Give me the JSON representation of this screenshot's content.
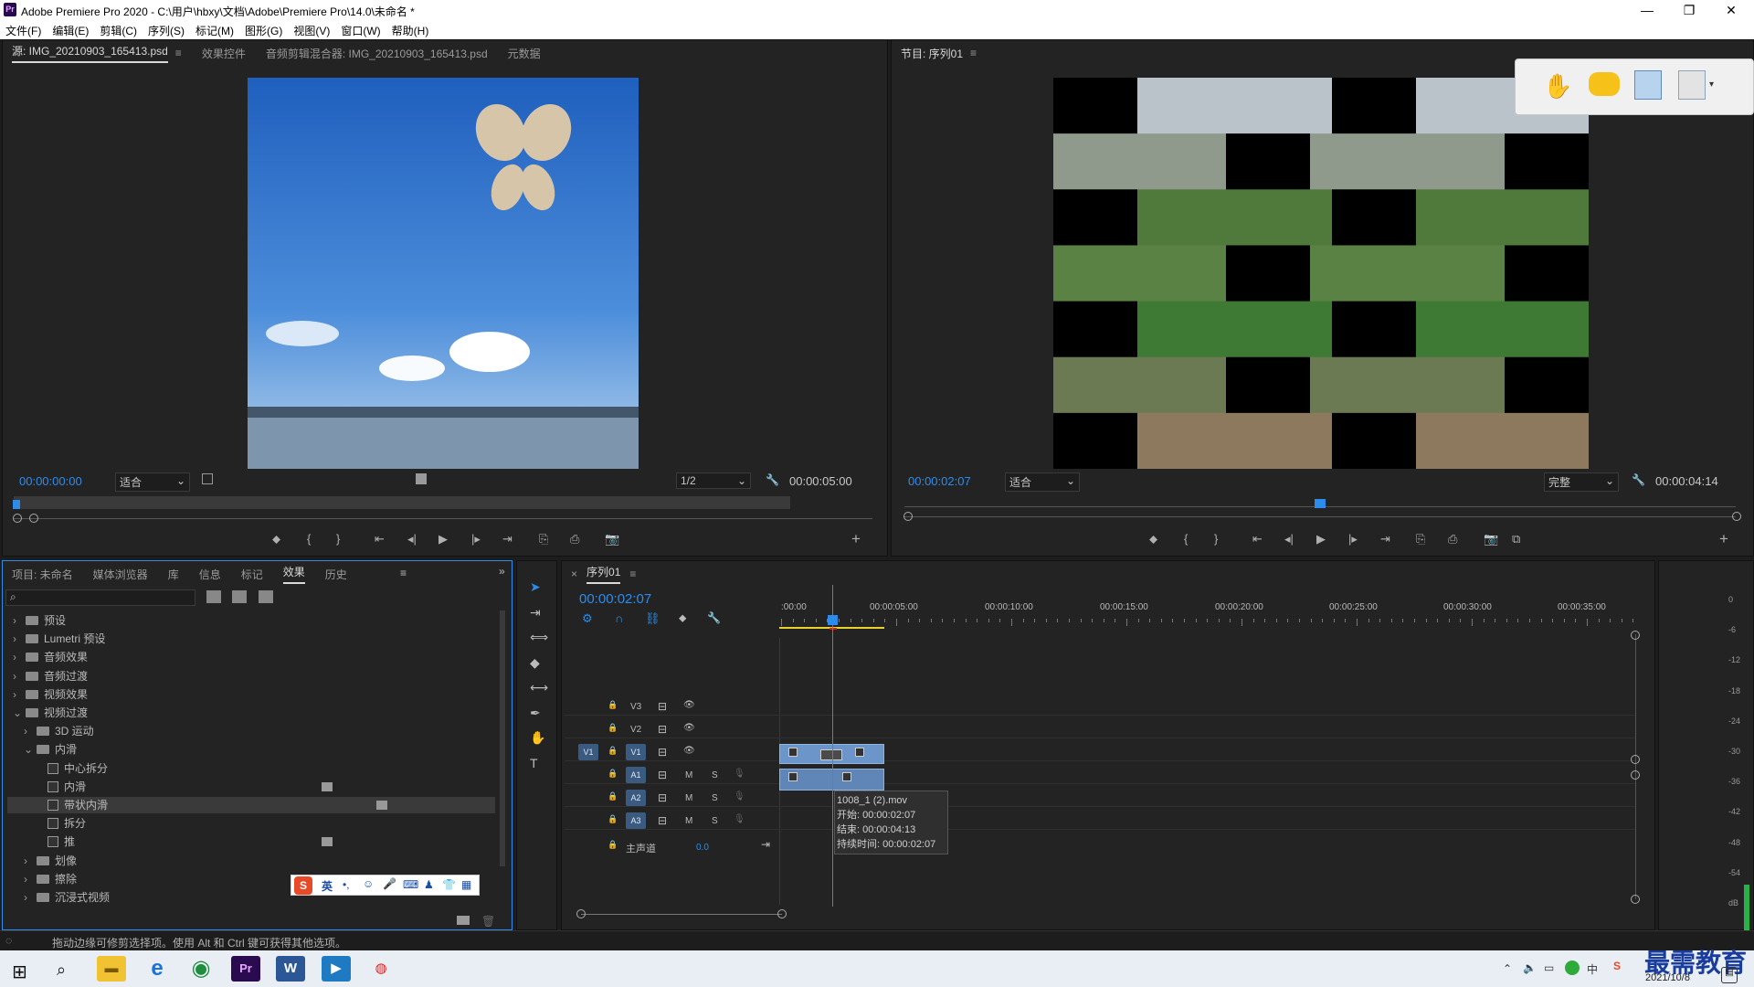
{
  "window": {
    "title": "Adobe Premiere Pro 2020 - C:\\用户\\hbxy\\文档\\Adobe\\Premiere Pro\\14.0\\未命名 *",
    "logo": "Pr"
  },
  "menu": [
    "文件(F)",
    "编辑(E)",
    "剪辑(C)",
    "序列(S)",
    "标记(M)",
    "图形(G)",
    "视图(V)",
    "窗口(W)",
    "帮助(H)"
  ],
  "source_monitor": {
    "tabs": [
      "源: IMG_20210903_165413.psd",
      "效果控件",
      "音频剪辑混合器: IMG_20210903_165413.psd",
      "元数据"
    ],
    "timecode": "00:00:00:00",
    "fit": "适合",
    "resolution": "1/2",
    "duration": "00:00:05:00"
  },
  "program_monitor": {
    "title": "节目: 序列01",
    "timecode": "00:00:02:07",
    "fit": "适合",
    "quality": "完整",
    "duration": "00:00:04:14"
  },
  "project_panel": {
    "tabs": [
      "项目: 未命名",
      "媒体浏览器",
      "库",
      "信息",
      "标记",
      "效果",
      "历史"
    ],
    "active_tab": "效果",
    "tree": [
      {
        "label": "预设",
        "indent": 0,
        "kind": "folder",
        "open": false
      },
      {
        "label": "Lumetri 预设",
        "indent": 0,
        "kind": "folder",
        "open": false
      },
      {
        "label": "音频效果",
        "indent": 0,
        "kind": "folder",
        "open": false
      },
      {
        "label": "音频过渡",
        "indent": 0,
        "kind": "folder",
        "open": false
      },
      {
        "label": "视频效果",
        "indent": 0,
        "kind": "folder",
        "open": false
      },
      {
        "label": "视频过渡",
        "indent": 0,
        "kind": "folder",
        "open": true
      },
      {
        "label": "3D 运动",
        "indent": 1,
        "kind": "folder",
        "open": false
      },
      {
        "label": "内滑",
        "indent": 1,
        "kind": "folder",
        "open": true
      },
      {
        "label": "中心拆分",
        "indent": 2,
        "kind": "fx"
      },
      {
        "label": "内滑",
        "indent": 2,
        "kind": "fx"
      },
      {
        "label": "带状内滑",
        "indent": 2,
        "kind": "fx",
        "selected": true
      },
      {
        "label": "拆分",
        "indent": 2,
        "kind": "fx"
      },
      {
        "label": "推",
        "indent": 2,
        "kind": "fx"
      },
      {
        "label": "划像",
        "indent": 1,
        "kind": "folder",
        "open": false
      },
      {
        "label": "擦除",
        "indent": 1,
        "kind": "folder",
        "open": false
      },
      {
        "label": "沉浸式视频",
        "indent": 1,
        "kind": "folder",
        "open": false
      }
    ],
    "ime_text": "英"
  },
  "timeline": {
    "tab": "序列01",
    "timecode": "00:00:02:07",
    "ruler": [
      ":00:00",
      "00:00:05:00",
      "00:00:10:00",
      "00:00:15:00",
      "00:00:20:00",
      "00:00:25:00",
      "00:00:30:00",
      "00:00:35:00"
    ],
    "video_tracks": [
      "V3",
      "V2",
      "V1"
    ],
    "audio_tracks": [
      "A1",
      "A2",
      "A3"
    ],
    "source_patch": "V1",
    "master_label": "主声道",
    "master_value": "0.0",
    "tooltip": [
      "1008_1 (2).mov",
      "开始: 00:00:02:07",
      "结束: 00:00:04:13",
      "持续时间: 00:00:02:07"
    ]
  },
  "meter_labels": [
    "0",
    "-6",
    "-12",
    "-18",
    "-24",
    "-30",
    "-36",
    "-42",
    "-48",
    "-54",
    "dB"
  ],
  "status_bar": "拖动边缘可修剪选择项。使用 Alt 和 Ctrl 键可获得其他选项。",
  "taskbar": {
    "date": "2021/10/8",
    "watermark": "最需教育"
  },
  "colors": {
    "accent_blue": "#2d8ceb",
    "clip_blue": "#6c96c9",
    "panel_bg": "#232323"
  }
}
